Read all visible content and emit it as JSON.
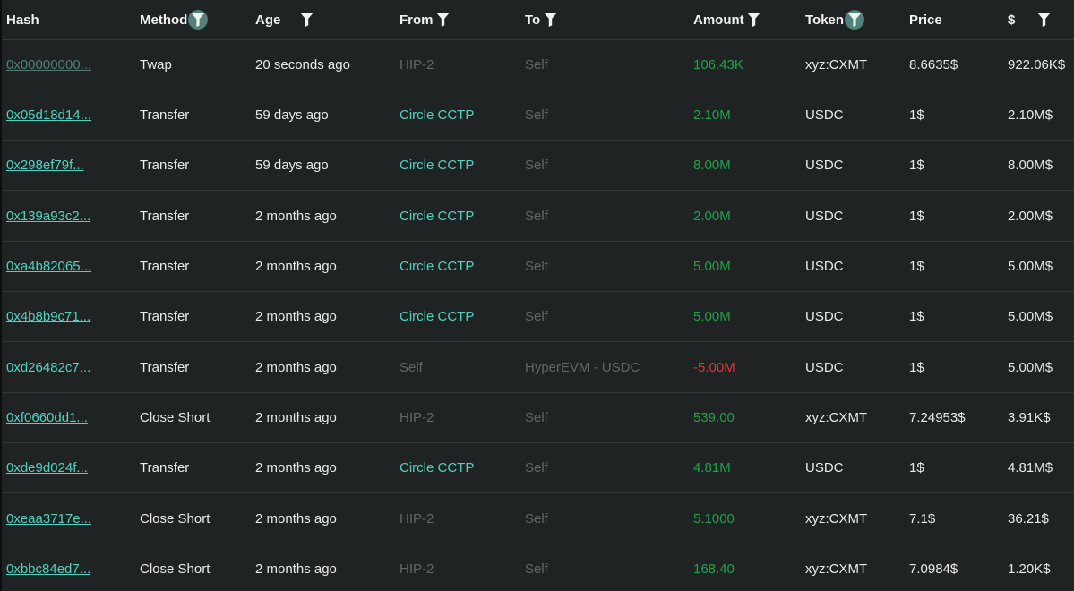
{
  "headers": {
    "hash": "Hash",
    "method": "Method",
    "age": "Age",
    "from": "From",
    "to": "To",
    "amount": "Amount",
    "token": "Token",
    "price": "Price",
    "usd": "$"
  },
  "icons": {
    "filter": "filter-icon",
    "filter_active": "filter-active-icon"
  },
  "colors": {
    "link": "#50d2c1",
    "positive": "#1fa24a",
    "negative": "#ed3030",
    "muted": "#5f6868",
    "background": "#1f2323"
  },
  "rows": [
    {
      "hash": "0x00000000...",
      "method": "Twap",
      "age": "20 seconds ago",
      "from": "HIP-2",
      "to": "Self",
      "amount": "106.43K",
      "token": "xyz:CXMT",
      "price": "8.6635$",
      "usd": "922.06K$"
    },
    {
      "hash": "0x05d18d14...",
      "method": "Transfer",
      "age": "59 days ago",
      "from": "Circle CCTP",
      "to": "Self",
      "amount": "2.10M",
      "token": "USDC",
      "price": "1$",
      "usd": "2.10M$"
    },
    {
      "hash": "0x298ef79f...",
      "method": "Transfer",
      "age": "59 days ago",
      "from": "Circle CCTP",
      "to": "Self",
      "amount": "8.00M",
      "token": "USDC",
      "price": "1$",
      "usd": "8.00M$"
    },
    {
      "hash": "0x139a93c2...",
      "method": "Transfer",
      "age": "2 months ago",
      "from": "Circle CCTP",
      "to": "Self",
      "amount": "2.00M",
      "token": "USDC",
      "price": "1$",
      "usd": "2.00M$"
    },
    {
      "hash": "0xa4b82065...",
      "method": "Transfer",
      "age": "2 months ago",
      "from": "Circle CCTP",
      "to": "Self",
      "amount": "5.00M",
      "token": "USDC",
      "price": "1$",
      "usd": "5.00M$"
    },
    {
      "hash": "0x4b8b9c71...",
      "method": "Transfer",
      "age": "2 months ago",
      "from": "Circle CCTP",
      "to": "Self",
      "amount": "5.00M",
      "token": "USDC",
      "price": "1$",
      "usd": "5.00M$"
    },
    {
      "hash": "0xd26482c7...",
      "method": "Transfer",
      "age": "2 months ago",
      "from": "Self",
      "to": "HyperEVM - USDC",
      "amount": "-5.00M",
      "token": "USDC",
      "price": "1$",
      "usd": "5.00M$"
    },
    {
      "hash": "0xf0660dd1...",
      "method": "Close Short",
      "age": "2 months ago",
      "from": "HIP-2",
      "to": "Self",
      "amount": "539.00",
      "token": "xyz:CXMT",
      "price": "7.24953$",
      "usd": "3.91K$"
    },
    {
      "hash": "0xde9d024f...",
      "method": "Transfer",
      "age": "2 months ago",
      "from": "Circle CCTP",
      "to": "Self",
      "amount": "4.81M",
      "token": "USDC",
      "price": "1$",
      "usd": "4.81M$"
    },
    {
      "hash": "0xeaa3717e...",
      "method": "Close Short",
      "age": "2 months ago",
      "from": "HIP-2",
      "to": "Self",
      "amount": "5.1000",
      "token": "xyz:CXMT",
      "price": "7.1$",
      "usd": "36.21$"
    },
    {
      "hash": "0xbbc84ed7...",
      "method": "Close Short",
      "age": "2 months ago",
      "from": "HIP-2",
      "to": "Self",
      "amount": "168.40",
      "token": "xyz:CXMT",
      "price": "7.0984$",
      "usd": "1.20K$"
    }
  ]
}
